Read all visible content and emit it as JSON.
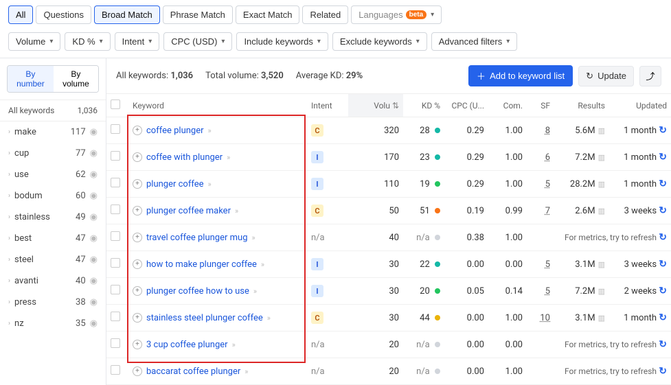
{
  "tabs": {
    "items": [
      "All",
      "Questions",
      "Broad Match",
      "Phrase Match",
      "Exact Match",
      "Related"
    ],
    "active": [
      0,
      2
    ],
    "languages_label": "Languages",
    "beta": "beta"
  },
  "filters": [
    "Volume",
    "KD %",
    "Intent",
    "CPC (USD)",
    "Include keywords",
    "Exclude keywords",
    "Advanced filters"
  ],
  "sidebar": {
    "toggle": {
      "by_number": "By number",
      "by_volume": "By volume",
      "active": "by_number"
    },
    "head_label": "All keywords",
    "head_count": "1,036",
    "items": [
      {
        "label": "make",
        "count": "117"
      },
      {
        "label": "cup",
        "count": "77"
      },
      {
        "label": "use",
        "count": "62"
      },
      {
        "label": "bodum",
        "count": "60"
      },
      {
        "label": "stainless",
        "count": "49"
      },
      {
        "label": "best",
        "count": "47"
      },
      {
        "label": "steel",
        "count": "47"
      },
      {
        "label": "avanti",
        "count": "40"
      },
      {
        "label": "press",
        "count": "38"
      },
      {
        "label": "nz",
        "count": "35"
      }
    ]
  },
  "summary": {
    "all_keywords_label": "All keywords:",
    "all_keywords_value": "1,036",
    "total_volume_label": "Total volume:",
    "total_volume_value": "3,520",
    "avg_kd_label": "Average KD:",
    "avg_kd_value": "29%",
    "add_btn": "Add to keyword list",
    "update_btn": "Update"
  },
  "columns": {
    "keyword": "Keyword",
    "intent": "Intent",
    "volume": "Volu",
    "kd": "KD %",
    "cpc": "CPC (U...",
    "com": "Com.",
    "sf": "SF",
    "results": "Results",
    "updated": "Updated"
  },
  "rows": [
    {
      "keyword": "coffee plunger",
      "intent": "C",
      "volume": "320",
      "kd": "28",
      "kd_dot": "teal",
      "cpc": "0.29",
      "com": "1.00",
      "sf": "8",
      "results": "5.6M",
      "updated": "1 month",
      "refreshable": "metrics"
    },
    {
      "keyword": "coffee with plunger",
      "intent": "I",
      "volume": "170",
      "kd": "23",
      "kd_dot": "teal",
      "cpc": "0.29",
      "com": "1.00",
      "sf": "6",
      "results": "7.2M",
      "updated": "1 month",
      "refreshable": "metrics"
    },
    {
      "keyword": "plunger coffee",
      "intent": "I",
      "volume": "110",
      "kd": "19",
      "kd_dot": "green",
      "cpc": "0.29",
      "com": "1.00",
      "sf": "5",
      "results": "28.2M",
      "updated": "1 month",
      "refreshable": "metrics"
    },
    {
      "keyword": "plunger coffee maker",
      "intent": "C",
      "volume": "50",
      "kd": "51",
      "kd_dot": "orange",
      "cpc": "0.19",
      "com": "0.99",
      "sf": "7",
      "results": "2.6M",
      "updated": "3 weeks",
      "refreshable": "metrics"
    },
    {
      "keyword": "travel coffee plunger mug",
      "intent": "na",
      "volume": "40",
      "kd": "n/a",
      "kd_dot": "grey",
      "cpc": "0.38",
      "com": "1.00",
      "sf": "",
      "results": "",
      "updated": "",
      "refreshable": "text"
    },
    {
      "keyword": "how to make plunger coffee",
      "intent": "I",
      "volume": "30",
      "kd": "22",
      "kd_dot": "teal",
      "cpc": "0.00",
      "com": "0.00",
      "sf": "5",
      "results": "3.1M",
      "updated": "3 weeks",
      "refreshable": "metrics"
    },
    {
      "keyword": "plunger coffee how to use",
      "intent": "I",
      "volume": "30",
      "kd": "20",
      "kd_dot": "green",
      "cpc": "0.05",
      "com": "0.14",
      "sf": "5",
      "results": "7.2M",
      "updated": "2 weeks",
      "refreshable": "metrics"
    },
    {
      "keyword": "stainless steel plunger coffee",
      "intent": "C",
      "volume": "30",
      "kd": "44",
      "kd_dot": "yellow",
      "cpc": "0.00",
      "com": "1.00",
      "sf": "10",
      "results": "3.1M",
      "updated": "1 month",
      "refreshable": "metrics"
    },
    {
      "keyword": "3 cup coffee plunger",
      "intent": "na",
      "volume": "20",
      "kd": "n/a",
      "kd_dot": "grey",
      "cpc": "0.00",
      "com": "0.00",
      "sf": "",
      "results": "",
      "updated": "",
      "refreshable": "text"
    },
    {
      "keyword": "baccarat coffee plunger",
      "intent": "na",
      "volume": "20",
      "kd": "n/a",
      "kd_dot": "grey",
      "cpc": "0.00",
      "com": "1.00",
      "sf": "",
      "results": "",
      "updated": "",
      "refreshable": "text"
    }
  ],
  "refresh_text": "For metrics, try to refresh"
}
